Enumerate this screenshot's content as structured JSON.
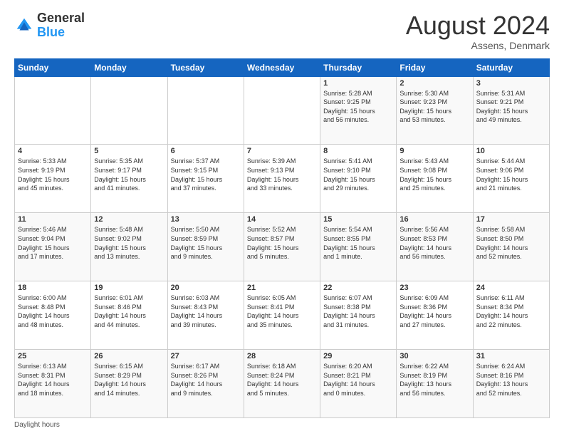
{
  "header": {
    "logo_general": "General",
    "logo_blue": "Blue",
    "month_title": "August 2024",
    "location": "Assens, Denmark"
  },
  "days_of_week": [
    "Sunday",
    "Monday",
    "Tuesday",
    "Wednesday",
    "Thursday",
    "Friday",
    "Saturday"
  ],
  "footer": {
    "daylight_note": "Daylight hours"
  },
  "weeks": [
    [
      {
        "day": "",
        "info": ""
      },
      {
        "day": "",
        "info": ""
      },
      {
        "day": "",
        "info": ""
      },
      {
        "day": "",
        "info": ""
      },
      {
        "day": "1",
        "info": "Sunrise: 5:28 AM\nSunset: 9:25 PM\nDaylight: 15 hours\nand 56 minutes."
      },
      {
        "day": "2",
        "info": "Sunrise: 5:30 AM\nSunset: 9:23 PM\nDaylight: 15 hours\nand 53 minutes."
      },
      {
        "day": "3",
        "info": "Sunrise: 5:31 AM\nSunset: 9:21 PM\nDaylight: 15 hours\nand 49 minutes."
      }
    ],
    [
      {
        "day": "4",
        "info": "Sunrise: 5:33 AM\nSunset: 9:19 PM\nDaylight: 15 hours\nand 45 minutes."
      },
      {
        "day": "5",
        "info": "Sunrise: 5:35 AM\nSunset: 9:17 PM\nDaylight: 15 hours\nand 41 minutes."
      },
      {
        "day": "6",
        "info": "Sunrise: 5:37 AM\nSunset: 9:15 PM\nDaylight: 15 hours\nand 37 minutes."
      },
      {
        "day": "7",
        "info": "Sunrise: 5:39 AM\nSunset: 9:13 PM\nDaylight: 15 hours\nand 33 minutes."
      },
      {
        "day": "8",
        "info": "Sunrise: 5:41 AM\nSunset: 9:10 PM\nDaylight: 15 hours\nand 29 minutes."
      },
      {
        "day": "9",
        "info": "Sunrise: 5:43 AM\nSunset: 9:08 PM\nDaylight: 15 hours\nand 25 minutes."
      },
      {
        "day": "10",
        "info": "Sunrise: 5:44 AM\nSunset: 9:06 PM\nDaylight: 15 hours\nand 21 minutes."
      }
    ],
    [
      {
        "day": "11",
        "info": "Sunrise: 5:46 AM\nSunset: 9:04 PM\nDaylight: 15 hours\nand 17 minutes."
      },
      {
        "day": "12",
        "info": "Sunrise: 5:48 AM\nSunset: 9:02 PM\nDaylight: 15 hours\nand 13 minutes."
      },
      {
        "day": "13",
        "info": "Sunrise: 5:50 AM\nSunset: 8:59 PM\nDaylight: 15 hours\nand 9 minutes."
      },
      {
        "day": "14",
        "info": "Sunrise: 5:52 AM\nSunset: 8:57 PM\nDaylight: 15 hours\nand 5 minutes."
      },
      {
        "day": "15",
        "info": "Sunrise: 5:54 AM\nSunset: 8:55 PM\nDaylight: 15 hours\nand 1 minute."
      },
      {
        "day": "16",
        "info": "Sunrise: 5:56 AM\nSunset: 8:53 PM\nDaylight: 14 hours\nand 56 minutes."
      },
      {
        "day": "17",
        "info": "Sunrise: 5:58 AM\nSunset: 8:50 PM\nDaylight: 14 hours\nand 52 minutes."
      }
    ],
    [
      {
        "day": "18",
        "info": "Sunrise: 6:00 AM\nSunset: 8:48 PM\nDaylight: 14 hours\nand 48 minutes."
      },
      {
        "day": "19",
        "info": "Sunrise: 6:01 AM\nSunset: 8:46 PM\nDaylight: 14 hours\nand 44 minutes."
      },
      {
        "day": "20",
        "info": "Sunrise: 6:03 AM\nSunset: 8:43 PM\nDaylight: 14 hours\nand 39 minutes."
      },
      {
        "day": "21",
        "info": "Sunrise: 6:05 AM\nSunset: 8:41 PM\nDaylight: 14 hours\nand 35 minutes."
      },
      {
        "day": "22",
        "info": "Sunrise: 6:07 AM\nSunset: 8:38 PM\nDaylight: 14 hours\nand 31 minutes."
      },
      {
        "day": "23",
        "info": "Sunrise: 6:09 AM\nSunset: 8:36 PM\nDaylight: 14 hours\nand 27 minutes."
      },
      {
        "day": "24",
        "info": "Sunrise: 6:11 AM\nSunset: 8:34 PM\nDaylight: 14 hours\nand 22 minutes."
      }
    ],
    [
      {
        "day": "25",
        "info": "Sunrise: 6:13 AM\nSunset: 8:31 PM\nDaylight: 14 hours\nand 18 minutes."
      },
      {
        "day": "26",
        "info": "Sunrise: 6:15 AM\nSunset: 8:29 PM\nDaylight: 14 hours\nand 14 minutes."
      },
      {
        "day": "27",
        "info": "Sunrise: 6:17 AM\nSunset: 8:26 PM\nDaylight: 14 hours\nand 9 minutes."
      },
      {
        "day": "28",
        "info": "Sunrise: 6:18 AM\nSunset: 8:24 PM\nDaylight: 14 hours\nand 5 minutes."
      },
      {
        "day": "29",
        "info": "Sunrise: 6:20 AM\nSunset: 8:21 PM\nDaylight: 14 hours\nand 0 minutes."
      },
      {
        "day": "30",
        "info": "Sunrise: 6:22 AM\nSunset: 8:19 PM\nDaylight: 13 hours\nand 56 minutes."
      },
      {
        "day": "31",
        "info": "Sunrise: 6:24 AM\nSunset: 8:16 PM\nDaylight: 13 hours\nand 52 minutes."
      }
    ]
  ]
}
